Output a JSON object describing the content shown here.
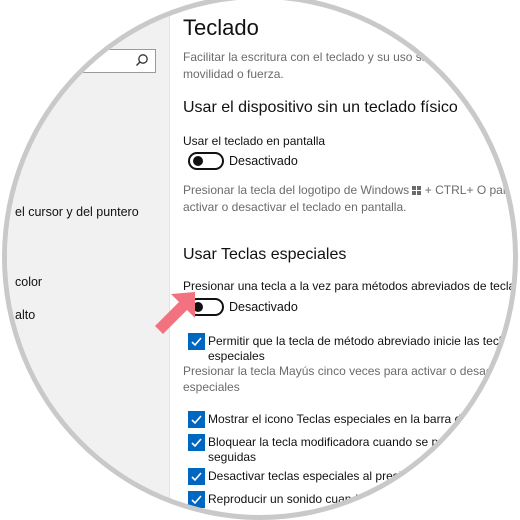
{
  "sidebar": {
    "search_placeholder": "",
    "items": [
      {
        "label": "el cursor y del puntero"
      },
      {
        "label": "color"
      },
      {
        "label": "alto"
      }
    ]
  },
  "main": {
    "title": "Teclado",
    "intro": [
      "Facilitar la escritura con el teclado y su uso si tiene",
      "movilidad o fuerza."
    ],
    "section1": {
      "heading": "Usar el dispositivo sin un teclado físico",
      "setting_label": "Usar el teclado en pantalla",
      "toggle_state": "Desactivado",
      "hint": [
        "Presionar la tecla del logotipo de Windows ",
        " + CTRL+ O para",
        "activar o desactivar el teclado en pantalla."
      ]
    },
    "section2": {
      "heading": "Usar Teclas especiales",
      "setting_label": "Presionar una tecla a la vez para métodos abreviados de teclado",
      "toggle_state": "Desactivado",
      "checkboxes": [
        {
          "label_lines": [
            "Permitir que la tecla de método abreviado inicie las teclas",
            "especiales"
          ],
          "checked": true
        },
        {
          "label_lines": [
            "Mostrar el icono Teclas especiales en la barra de tareas"
          ],
          "checked": true
        },
        {
          "label_lines": [
            "Bloquear la tecla modificadora cuando se presiona",
            "seguidas"
          ],
          "checked": true
        },
        {
          "label_lines": [
            "Desactivar teclas especiales al presionar"
          ],
          "checked": true
        },
        {
          "label_lines": [
            "Reproducir un sonido cuando"
          ],
          "checked": true
        }
      ],
      "shortcut_hint": [
        "Presionar la tecla Mayús cinco veces para activar o desactivar Teclas",
        "especiales"
      ]
    }
  },
  "colors": {
    "accent": "#0067c0",
    "arrow": "#f2727f",
    "sidebar_bg": "#f1f1f1"
  }
}
